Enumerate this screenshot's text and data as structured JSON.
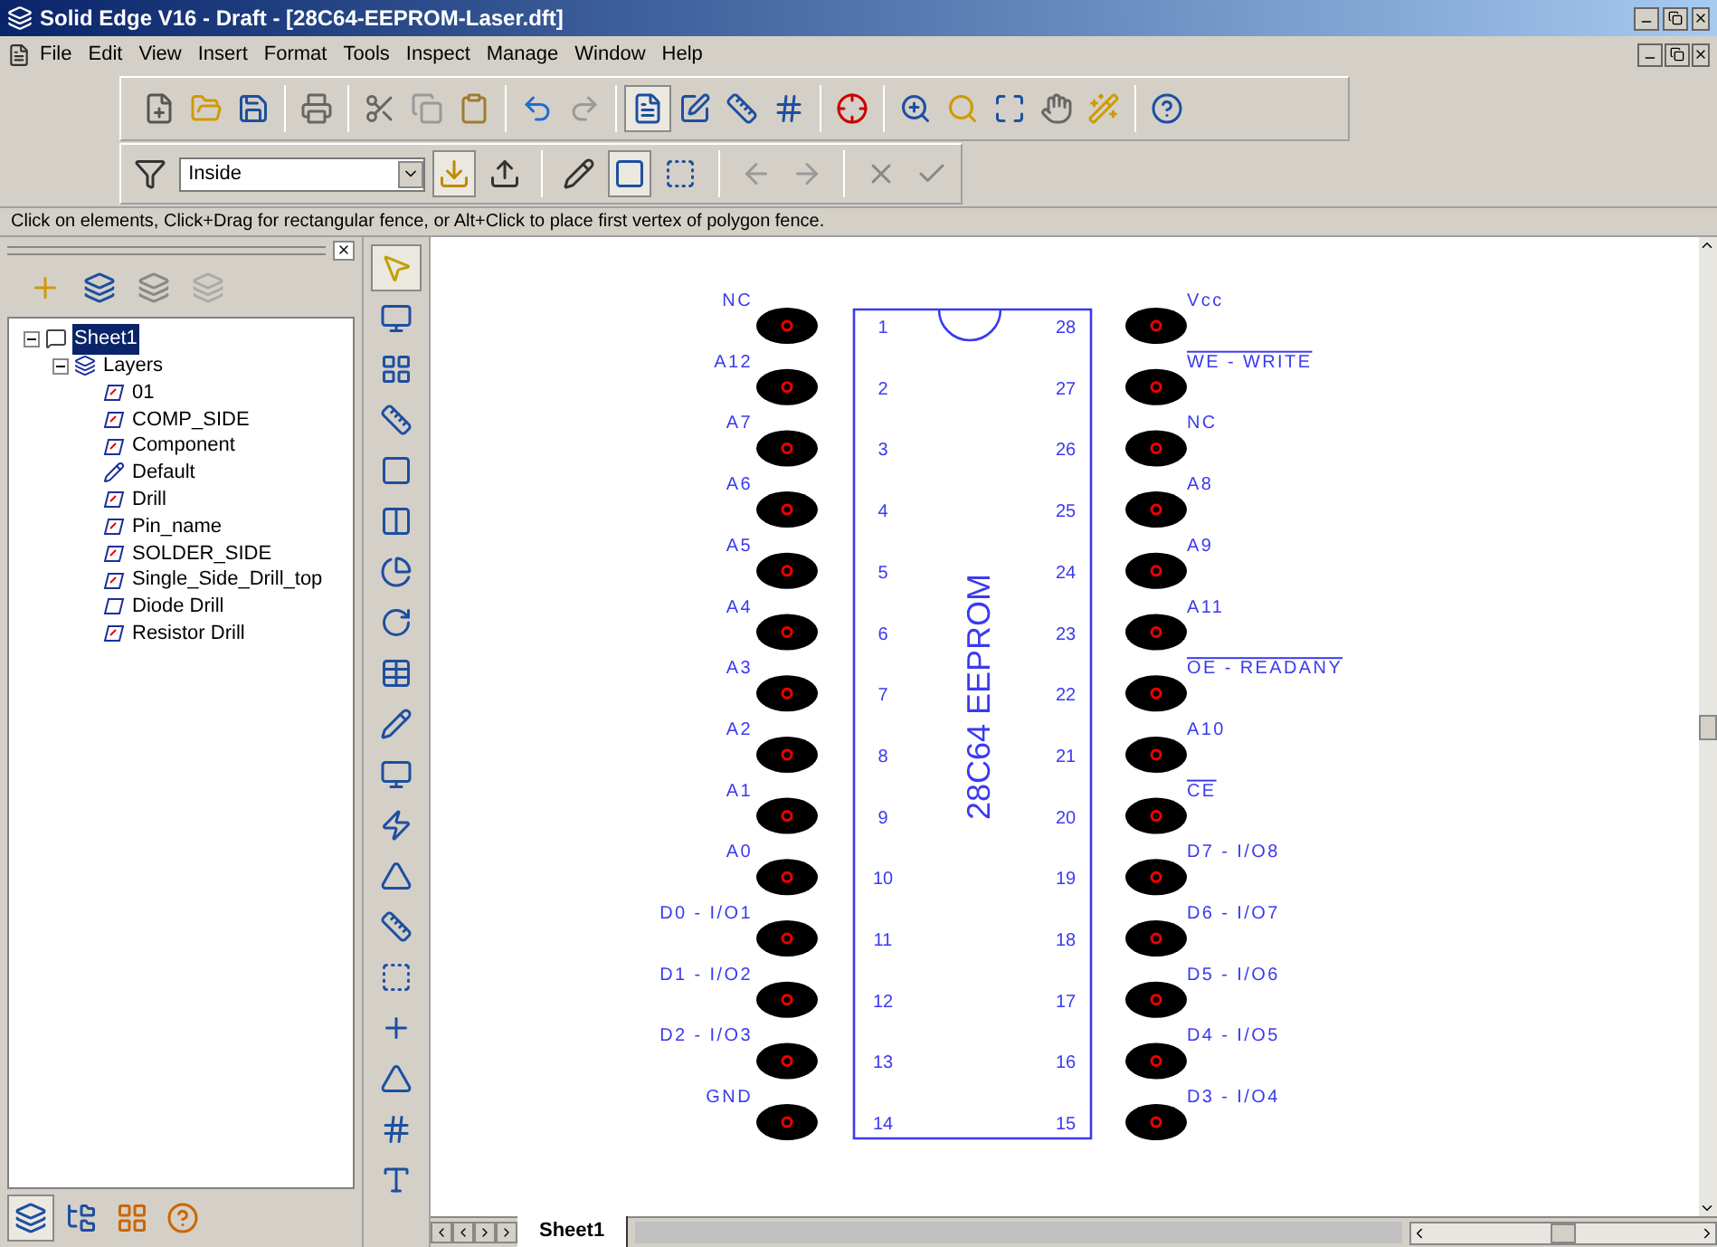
{
  "window": {
    "title": "Solid Edge V16 - Draft - [28C64-EEPROM-Laser.dft]"
  },
  "menu": [
    "File",
    "Edit",
    "View",
    "Insert",
    "Format",
    "Tools",
    "Inspect",
    "Manage",
    "Window",
    "Help"
  ],
  "fence_combo": {
    "value": "Inside"
  },
  "prompt": "Click on elements, Click+Drag for rectangular fence, or Alt+Click to place first vertex of polygon fence.",
  "tree": [
    {
      "label": "Sheet1",
      "selected": true,
      "expanded": true,
      "kind": "sheet",
      "children": [
        {
          "label": "Layers",
          "selected": false,
          "expanded": true,
          "kind": "layers",
          "children": [
            {
              "label": "01",
              "selected": false,
              "kind": "layer"
            },
            {
              "label": "COMP_SIDE",
              "selected": false,
              "kind": "layer"
            },
            {
              "label": "Component",
              "selected": false,
              "kind": "layer"
            },
            {
              "label": "Default",
              "selected": false,
              "kind": "active"
            },
            {
              "label": "Drill",
              "selected": false,
              "kind": "layer"
            },
            {
              "label": "Pin_name",
              "selected": false,
              "kind": "layer"
            },
            {
              "label": "SOLDER_SIDE",
              "selected": false,
              "kind": "layer"
            },
            {
              "label": "Single_Side_Drill_top",
              "selected": false,
              "kind": "layer"
            },
            {
              "label": "Diode Drill",
              "selected": false,
              "kind": "hidden"
            },
            {
              "label": "Resistor Drill",
              "selected": false,
              "kind": "layer"
            }
          ]
        }
      ]
    }
  ],
  "tools": [
    {
      "kind": "select",
      "selected": true
    },
    {
      "kind": "view",
      "selected": false
    },
    {
      "kind": "frame",
      "selected": false
    },
    {
      "kind": "section",
      "selected": false
    },
    {
      "kind": "projection",
      "selected": false
    },
    {
      "kind": "hatch",
      "selected": false
    },
    {
      "kind": "detail",
      "selected": false
    },
    {
      "kind": "rotate",
      "selected": false
    },
    {
      "kind": "table",
      "selected": false
    },
    {
      "kind": "sketch",
      "selected": false
    },
    {
      "kind": "view",
      "selected": false
    },
    {
      "kind": "dimension",
      "selected": false
    },
    {
      "kind": "angle",
      "selected": false
    },
    {
      "kind": "distance",
      "selected": false
    },
    {
      "kind": "centerline",
      "selected": false
    },
    {
      "kind": "leader",
      "selected": false
    },
    {
      "kind": "weld",
      "selected": false
    },
    {
      "kind": "callout",
      "selected": false
    },
    {
      "kind": "text",
      "selected": false
    }
  ],
  "chip": {
    "title": "28C64 EEPROM",
    "pins_left": [
      {
        "number": "1",
        "label": "NC",
        "active_low": false
      },
      {
        "number": "2",
        "label": "A12",
        "active_low": false
      },
      {
        "number": "3",
        "label": "A7",
        "active_low": false
      },
      {
        "number": "4",
        "label": "A6",
        "active_low": false
      },
      {
        "number": "5",
        "label": "A5",
        "active_low": false
      },
      {
        "number": "6",
        "label": "A4",
        "active_low": false
      },
      {
        "number": "7",
        "label": "A3",
        "active_low": false
      },
      {
        "number": "8",
        "label": "A2",
        "active_low": false
      },
      {
        "number": "9",
        "label": "A1",
        "active_low": false
      },
      {
        "number": "10",
        "label": "A0",
        "active_low": false
      },
      {
        "number": "11",
        "label": "D0 - I/O1",
        "active_low": false
      },
      {
        "number": "12",
        "label": "D1 - I/O2",
        "active_low": false
      },
      {
        "number": "13",
        "label": "D2 - I/O3",
        "active_low": false
      },
      {
        "number": "14",
        "label": "GND",
        "active_low": false
      }
    ],
    "pins_right": [
      {
        "number": "28",
        "label": "Vcc",
        "active_low": false
      },
      {
        "number": "27",
        "label": "WE - WRITE",
        "active_low": true
      },
      {
        "number": "26",
        "label": "NC",
        "active_low": false
      },
      {
        "number": "25",
        "label": "A8",
        "active_low": false
      },
      {
        "number": "24",
        "label": "A9",
        "active_low": false
      },
      {
        "number": "23",
        "label": "A11",
        "active_low": false
      },
      {
        "number": "22",
        "label": "OE - READANY",
        "active_low": true
      },
      {
        "number": "21",
        "label": "A10",
        "active_low": false
      },
      {
        "number": "20",
        "label": "CE",
        "active_low": true
      },
      {
        "number": "19",
        "label": "D7 - I/O8",
        "active_low": false
      },
      {
        "number": "18",
        "label": "D6 - I/O7",
        "active_low": false
      },
      {
        "number": "17",
        "label": "D5 - I/O6",
        "active_low": false
      },
      {
        "number": "16",
        "label": "D4 - I/O5",
        "active_low": false
      },
      {
        "number": "15",
        "label": "D3 - I/O4",
        "active_low": false
      }
    ]
  },
  "sheet_tabs": [
    {
      "label": "Sheet1",
      "selected": true
    }
  ]
}
